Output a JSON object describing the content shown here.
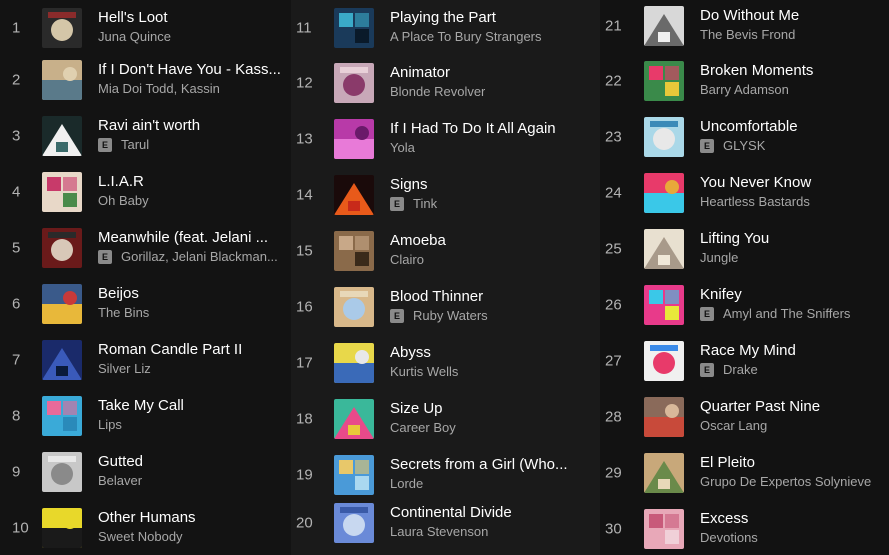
{
  "columns": [
    {
      "tracks": [
        {
          "num": "1",
          "title": "Hell's Loot",
          "artist": "Juna Quince",
          "explicit": false,
          "cover": [
            "#2a2a2a",
            "#d4c6a8",
            "#8a2b2b"
          ]
        },
        {
          "num": "2",
          "title": "If I Don't Have You - Kass...",
          "artist": "Mia Doi Todd, Kassin",
          "explicit": false,
          "cover": [
            "#c8b08a",
            "#5a7a8a",
            "#e0d0b0"
          ]
        },
        {
          "num": "3",
          "title": "Ravi ain't worth",
          "artist": "Tarul",
          "explicit": true,
          "cover": [
            "#1a2a2a",
            "#f0f0f0",
            "#3a6a6a"
          ]
        },
        {
          "num": "4",
          "title": "L.I.A.R",
          "artist": "Oh Baby",
          "explicit": false,
          "cover": [
            "#e8d8c8",
            "#c83a6a",
            "#4a8a4a"
          ]
        },
        {
          "num": "5",
          "title": "Meanwhile (feat. Jelani ...",
          "artist": "Gorillaz, Jelani Blackman...",
          "explicit": true,
          "cover": [
            "#6a1a1a",
            "#d8c8b8",
            "#2a2a2a"
          ]
        },
        {
          "num": "6",
          "title": "Beijos",
          "artist": "The Bins",
          "explicit": false,
          "cover": [
            "#3a5a8a",
            "#e8b83a",
            "#c83a3a"
          ]
        },
        {
          "num": "7",
          "title": "Roman Candle Part II",
          "artist": "Silver Liz",
          "explicit": false,
          "cover": [
            "#1a2a6a",
            "#3a5aba",
            "#0a1a3a"
          ]
        },
        {
          "num": "8",
          "title": "Take My Call",
          "artist": "Lips",
          "explicit": false,
          "cover": [
            "#3aaad8",
            "#e86a9a",
            "#2a8aba"
          ]
        },
        {
          "num": "9",
          "title": "Gutted",
          "artist": "Belaver",
          "explicit": false,
          "cover": [
            "#c8c8c8",
            "#8a8a8a",
            "#e8e8e8"
          ]
        },
        {
          "num": "10",
          "title": "Other Humans",
          "artist": "Sweet Nobody",
          "explicit": false,
          "cover": [
            "#e8d82a",
            "#1a1a1a",
            "#e8d82a"
          ]
        }
      ]
    },
    {
      "tracks": [
        {
          "num": "11",
          "title": "Playing the Part",
          "artist": "A Place To Bury Strangers",
          "explicit": false,
          "cover": [
            "#1a3a5a",
            "#3aaac8",
            "#0a1a2a"
          ]
        },
        {
          "num": "12",
          "title": "Animator",
          "artist": "Blonde Revolver",
          "explicit": false,
          "cover": [
            "#c8a8b8",
            "#8a3a6a",
            "#e8d0d8"
          ]
        },
        {
          "num": "13",
          "title": "If I Had To Do It All Again",
          "artist": "Yola",
          "explicit": false,
          "cover": [
            "#b83aa8",
            "#e87ad8",
            "#6a1a6a"
          ]
        },
        {
          "num": "14",
          "title": "Signs",
          "artist": "Tink",
          "explicit": true,
          "cover": [
            "#1a0a0a",
            "#e85a1a",
            "#c82a1a"
          ]
        },
        {
          "num": "15",
          "title": "Amoeba",
          "artist": "Clairo",
          "explicit": false,
          "cover": [
            "#8a6a4a",
            "#c8a888",
            "#3a2a1a"
          ]
        },
        {
          "num": "16",
          "title": "Blood Thinner",
          "artist": "Ruby Waters",
          "explicit": true,
          "cover": [
            "#d8b88a",
            "#aacae8",
            "#e8d8b8"
          ]
        },
        {
          "num": "17",
          "title": "Abyss",
          "artist": "Kurtis Wells",
          "explicit": false,
          "cover": [
            "#e8d84a",
            "#3a6ab8",
            "#e8e8e8"
          ]
        },
        {
          "num": "18",
          "title": "Size Up",
          "artist": "Career Boy",
          "explicit": false,
          "cover": [
            "#3ab89a",
            "#e84a8a",
            "#e8c83a"
          ]
        },
        {
          "num": "19",
          "title": "Secrets from a Girl (Who...",
          "artist": "Lorde",
          "explicit": false,
          "cover": [
            "#4a9ad8",
            "#e8c86a",
            "#aad8f0"
          ]
        },
        {
          "num": "20",
          "title": "Continental Divide",
          "artist": "Laura Stevenson",
          "explicit": false,
          "cover": [
            "#6a8ad8",
            "#c8d8f0",
            "#3a5aa8"
          ]
        }
      ]
    },
    {
      "tracks": [
        {
          "num": "21",
          "title": "Do Without Me",
          "artist": "The Bevis Frond",
          "explicit": false,
          "cover": [
            "#d8d8d8",
            "#6a6a6a",
            "#f0f0f0"
          ]
        },
        {
          "num": "22",
          "title": "Broken Moments",
          "artist": "Barry Adamson",
          "explicit": false,
          "cover": [
            "#3a8a4a",
            "#e83a6a",
            "#e8c83a"
          ]
        },
        {
          "num": "23",
          "title": "Uncomfortable",
          "artist": "GLYSK",
          "explicit": true,
          "cover": [
            "#aad8e8",
            "#e8e8e8",
            "#3a8ab8"
          ]
        },
        {
          "num": "24",
          "title": "You Never Know",
          "artist": "Heartless Bastards",
          "explicit": false,
          "cover": [
            "#e83a6a",
            "#3ac8e8",
            "#e8a83a"
          ]
        },
        {
          "num": "25",
          "title": "Lifting You",
          "artist": "Jungle",
          "explicit": false,
          "cover": [
            "#e8e0d0",
            "#a89a8a",
            "#f0e8d8"
          ]
        },
        {
          "num": "26",
          "title": "Knifey",
          "artist": "Amyl and The Sniffers",
          "explicit": true,
          "cover": [
            "#e83a8a",
            "#3ac8e8",
            "#e8e83a"
          ]
        },
        {
          "num": "27",
          "title": "Race My Mind",
          "artist": "Drake",
          "explicit": true,
          "cover": [
            "#f0f0f0",
            "#e83a6a",
            "#3a8ae8"
          ]
        },
        {
          "num": "28",
          "title": "Quarter Past Nine",
          "artist": "Oscar Lang",
          "explicit": false,
          "cover": [
            "#8a6a5a",
            "#c84a3a",
            "#d8b89a"
          ]
        },
        {
          "num": "29",
          "title": "El Pleito",
          "artist": "Grupo De Expertos Solynieve",
          "explicit": false,
          "cover": [
            "#c8a87a",
            "#6a8a4a",
            "#e8d8b8"
          ]
        },
        {
          "num": "30",
          "title": "Excess",
          "artist": "Devotions",
          "explicit": false,
          "cover": [
            "#e8a8b8",
            "#c85a7a",
            "#f0d0d8"
          ]
        }
      ]
    }
  ]
}
